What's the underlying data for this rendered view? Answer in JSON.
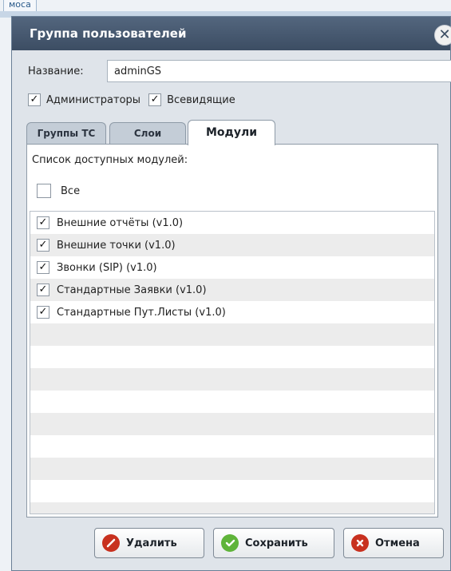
{
  "background": {
    "tab_label": "моса"
  },
  "dialog": {
    "title": "Группа пользователей",
    "close_symbol": "✕"
  },
  "form": {
    "name_label": "Название:",
    "name_value": "adminGS",
    "admins_label": "Администраторы",
    "admins_checked": true,
    "seeall_label": "Всевидящие",
    "seeall_checked": true
  },
  "tabs": [
    {
      "label": "Группы ТС",
      "active": false
    },
    {
      "label": "Слои",
      "active": false
    },
    {
      "label": "Модули",
      "active": true
    }
  ],
  "modules_panel": {
    "title": "Список доступных модулей:",
    "all_label": "Все",
    "all_checked": false,
    "items": [
      {
        "label": "Внешние отчёты (v1.0)",
        "checked": true
      },
      {
        "label": "Внешние точки (v1.0)",
        "checked": true
      },
      {
        "label": "Звонки (SIP) (v1.0)",
        "checked": true
      },
      {
        "label": "Стандартные Заявки (v1.0)",
        "checked": true
      },
      {
        "label": "Стандартные Пут.Листы (v1.0)",
        "checked": true
      }
    ]
  },
  "buttons": {
    "delete_label": "Удалить",
    "save_label": "Сохранить",
    "cancel_label": "Отмена"
  },
  "colors": {
    "titlebar": "#46596f",
    "delete_icon": "#c8311f",
    "save_icon": "#5fb43a",
    "cancel_icon": "#c8311f"
  },
  "icons": {
    "check": "✓",
    "delete": "no-entry-icon",
    "save": "checkmark-icon",
    "cancel": "x-circle-icon"
  }
}
